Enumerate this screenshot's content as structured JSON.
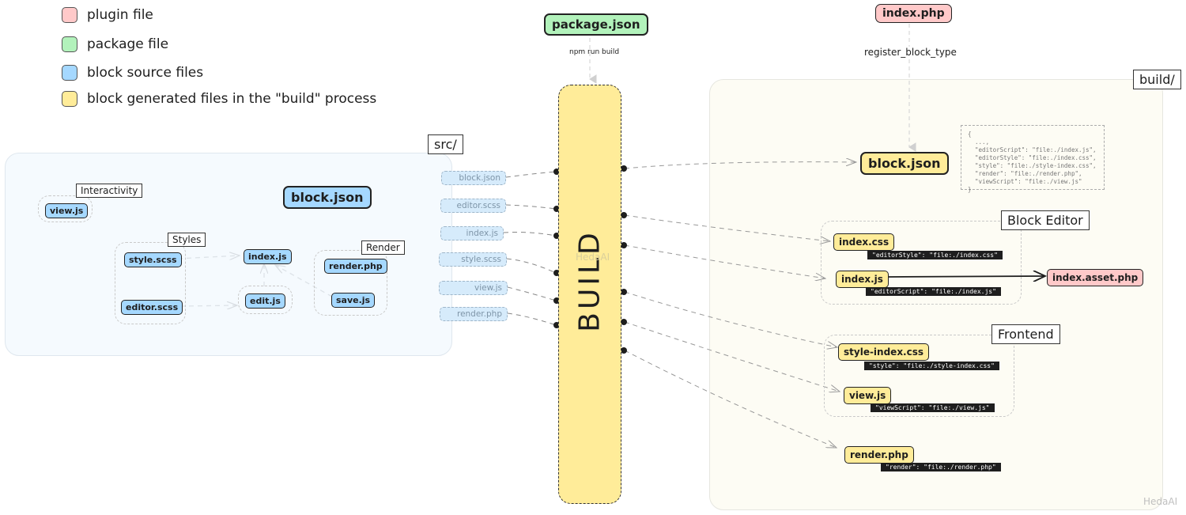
{
  "legend": [
    {
      "label": "plugin file",
      "color": "#ffc9c9"
    },
    {
      "label": "package file",
      "color": "#b2f2bb"
    },
    {
      "label": "block source files",
      "color": "#a5d8ff"
    },
    {
      "label": "block generated files in the \"build\" process",
      "color": "#ffec99"
    }
  ],
  "top": {
    "package_json": "package.json",
    "npm_caption": "npm run build",
    "index_php": "index.php",
    "register_caption": "register_block_type"
  },
  "src": {
    "label": "src/",
    "block_json": "block.json",
    "interactivity": {
      "label": "Interactivity",
      "files": [
        "view.js"
      ]
    },
    "styles": {
      "label": "Styles",
      "files": [
        "style.scss",
        "editor.scss"
      ]
    },
    "render": {
      "label": "Render",
      "files": [
        "render.php",
        "save.js"
      ]
    },
    "index_js": "index.js",
    "edit_js": "edit.js"
  },
  "build_inputs": [
    "block.json",
    "editor.scss",
    "index.js",
    "style.scss",
    "view.js",
    "render.php"
  ],
  "build": {
    "label": "BUILD",
    "watermark": "HedaAI"
  },
  "output": {
    "label": "build/",
    "block_json": "block.json",
    "block_json_code": "{\n  ...,\n  \"editorScript\": \"file:./index.js\",\n  \"editorStyle\": \"file:./index.css\",\n  \"style\": \"file:./style-index.css\",\n  \"render\": \"file:./render.php\",\n  \"viewScript\": \"file:./view.js\"\n}",
    "block_editor": {
      "label": "Block Editor",
      "files": [
        {
          "name": "index.css",
          "badge": "\"editorStyle\": \"file:./index.css\""
        },
        {
          "name": "index.js",
          "badge": "\"editorScript\": \"file:./index.js\""
        }
      ]
    },
    "index_asset_php": "index.asset.php",
    "frontend": {
      "label": "Frontend",
      "files": [
        {
          "name": "style-index.css",
          "badge": "\"style\": \"file:./style-index.css\""
        },
        {
          "name": "view.js",
          "badge": "\"viewScript\": \"file:./view.js\""
        }
      ]
    },
    "render_php": {
      "name": "render.php",
      "badge": "\"render\": \"file:./render.php\""
    }
  },
  "watermark": "HedaAI"
}
